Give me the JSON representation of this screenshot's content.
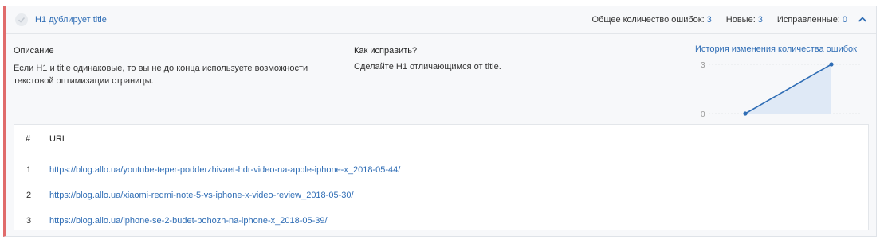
{
  "header": {
    "title": "H1 дублирует title",
    "total_label": "Общее количество ошибок:",
    "total_value": "3",
    "new_label": "Новые:",
    "new_value": "3",
    "fixed_label": "Исправленные:",
    "fixed_value": "0"
  },
  "description": {
    "heading": "Описание",
    "text": "Если H1 и title одинаковые, то вы не до конца используете возможности текстовой оптимизации страницы."
  },
  "fix": {
    "heading": "Как исправить?",
    "text": "Сделайте H1 отличающимся от title."
  },
  "history": {
    "link": "История изменения количества ошибок"
  },
  "chart_data": {
    "type": "area",
    "x": [
      1,
      2
    ],
    "values": [
      0,
      3
    ],
    "y_ticks": [
      "3",
      "0"
    ],
    "ylim": [
      0,
      3
    ],
    "accent": "#2f6db5"
  },
  "table": {
    "col_num": "#",
    "col_url": "URL",
    "rows": [
      {
        "n": "1",
        "url": "https://blog.allo.ua/youtube-teper-podderzhivaet-hdr-video-na-apple-iphone-x_2018-05-44/"
      },
      {
        "n": "2",
        "url": "https://blog.allo.ua/xiaomi-redmi-note-5-vs-iphone-x-video-review_2018-05-30/"
      },
      {
        "n": "3",
        "url": "https://blog.allo.ua/iphone-se-2-budet-pohozh-na-iphone-x_2018-05-39/"
      }
    ]
  }
}
